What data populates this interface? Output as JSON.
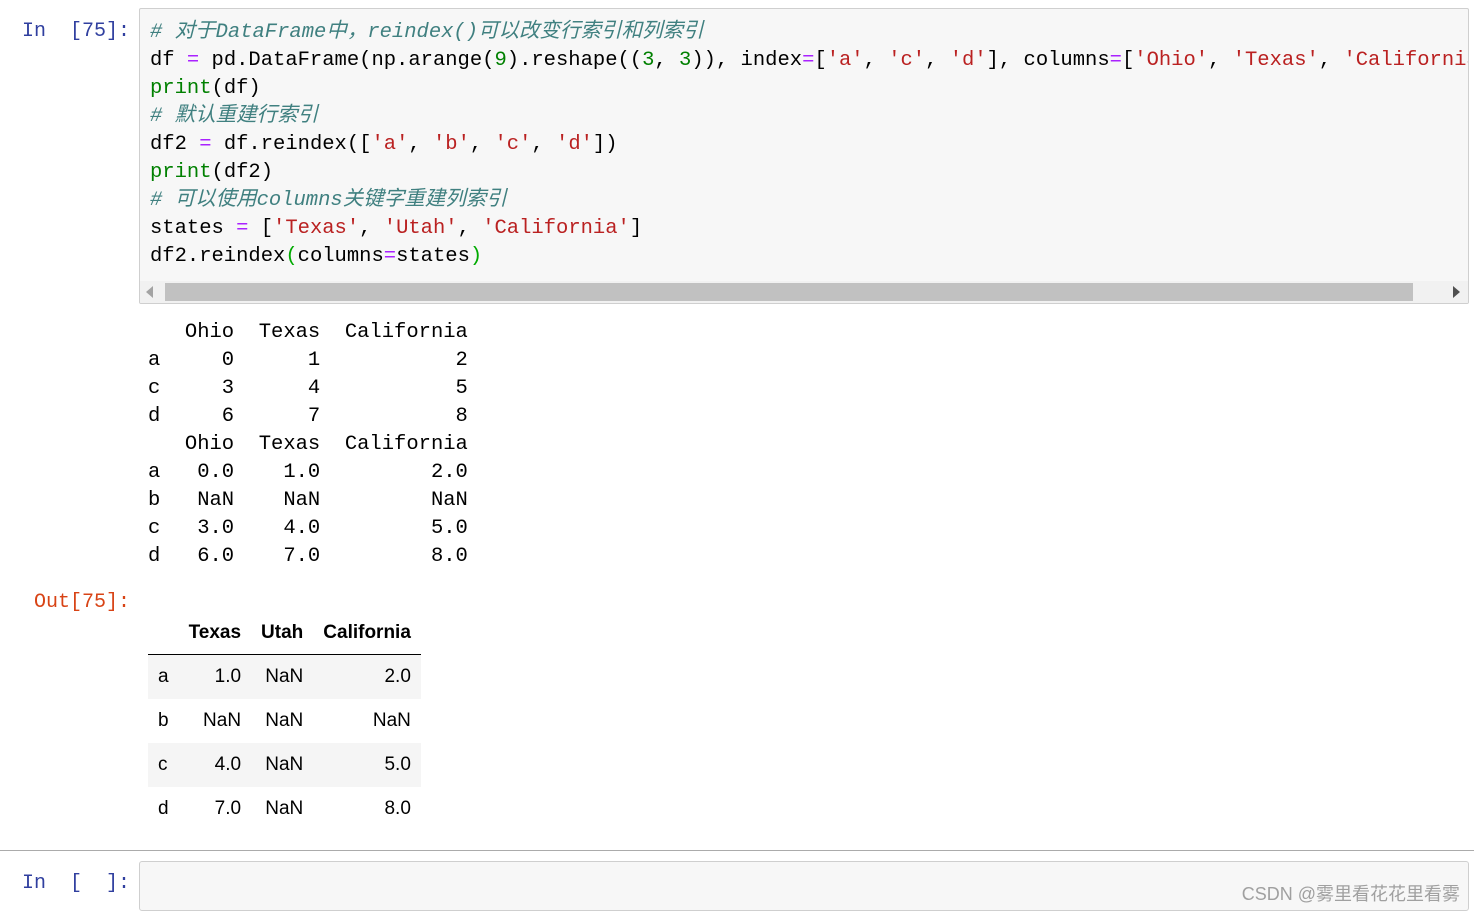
{
  "cell1": {
    "in_prompt": "In  [75]:",
    "out_prompt": "Out[75]:",
    "code": [
      [
        {
          "t": "# 对于DataFrame中，reindex()可以改变行索引和列索引",
          "c": "comment"
        }
      ],
      [
        {
          "t": "df ",
          "c": ""
        },
        {
          "t": "=",
          "c": "op"
        },
        {
          "t": " pd.DataFrame(np.arange(",
          "c": ""
        },
        {
          "t": "9",
          "c": "num"
        },
        {
          "t": ").reshape((",
          "c": ""
        },
        {
          "t": "3",
          "c": "num"
        },
        {
          "t": ", ",
          "c": ""
        },
        {
          "t": "3",
          "c": "num"
        },
        {
          "t": ")), index",
          "c": ""
        },
        {
          "t": "=",
          "c": "op"
        },
        {
          "t": "[",
          "c": ""
        },
        {
          "t": "'a'",
          "c": "str"
        },
        {
          "t": ", ",
          "c": ""
        },
        {
          "t": "'c'",
          "c": "str"
        },
        {
          "t": ", ",
          "c": ""
        },
        {
          "t": "'d'",
          "c": "str"
        },
        {
          "t": "], columns",
          "c": ""
        },
        {
          "t": "=",
          "c": "op"
        },
        {
          "t": "[",
          "c": ""
        },
        {
          "t": "'Ohio'",
          "c": "str"
        },
        {
          "t": ", ",
          "c": ""
        },
        {
          "t": "'Texas'",
          "c": "str"
        },
        {
          "t": ", ",
          "c": ""
        },
        {
          "t": "'California'",
          "c": "str"
        },
        {
          "t": "])",
          "c": ""
        }
      ],
      [
        {
          "t": "print",
          "c": "builtin"
        },
        {
          "t": "(df)",
          "c": ""
        }
      ],
      [
        {
          "t": "# 默认重建行索引",
          "c": "comment"
        }
      ],
      [
        {
          "t": "df2 ",
          "c": ""
        },
        {
          "t": "=",
          "c": "op"
        },
        {
          "t": " df.reindex([",
          "c": ""
        },
        {
          "t": "'a'",
          "c": "str"
        },
        {
          "t": ", ",
          "c": ""
        },
        {
          "t": "'b'",
          "c": "str"
        },
        {
          "t": ", ",
          "c": ""
        },
        {
          "t": "'c'",
          "c": "str"
        },
        {
          "t": ", ",
          "c": ""
        },
        {
          "t": "'d'",
          "c": "str"
        },
        {
          "t": "])",
          "c": ""
        }
      ],
      [
        {
          "t": "print",
          "c": "builtin"
        },
        {
          "t": "(df2)",
          "c": ""
        }
      ],
      [
        {
          "t": "# 可以使用columns关键字重建列索引",
          "c": "comment"
        }
      ],
      [
        {
          "t": "states ",
          "c": ""
        },
        {
          "t": "=",
          "c": "op"
        },
        {
          "t": " [",
          "c": ""
        },
        {
          "t": "'Texas'",
          "c": "str"
        },
        {
          "t": ", ",
          "c": ""
        },
        {
          "t": "'Utah'",
          "c": "str"
        },
        {
          "t": ", ",
          "c": ""
        },
        {
          "t": "'California'",
          "c": "str"
        },
        {
          "t": "]",
          "c": ""
        }
      ],
      [
        {
          "t": "df2.reindex",
          "c": ""
        },
        {
          "t": "(",
          "c": "paren-g"
        },
        {
          "t": "columns",
          "c": ""
        },
        {
          "t": "=",
          "c": "op"
        },
        {
          "t": "states",
          "c": ""
        },
        {
          "t": ")",
          "c": "paren-g"
        }
      ]
    ],
    "stdout": [
      "   Ohio  Texas  California",
      "a     0      1           2",
      "c     3      4           5",
      "d     6      7           8",
      "   Ohio  Texas  California",
      "a   0.0    1.0         2.0",
      "b   NaN    NaN         NaN",
      "c   3.0    4.0         5.0",
      "d   6.0    7.0         8.0"
    ],
    "result_table": {
      "columns": [
        "",
        "Texas",
        "Utah",
        "California"
      ],
      "rows": [
        [
          "a",
          "1.0",
          "NaN",
          "2.0"
        ],
        [
          "b",
          "NaN",
          "NaN",
          "NaN"
        ],
        [
          "c",
          "4.0",
          "NaN",
          "5.0"
        ],
        [
          "d",
          "7.0",
          "NaN",
          "8.0"
        ]
      ]
    }
  },
  "cell2": {
    "in_prompt": "In  [  ]:",
    "code": ""
  },
  "watermark": "CSDN @雾里看花花里看雾",
  "colors": {
    "in_prompt": "#303f9f",
    "out_prompt": "#d84315",
    "comment": "#408080",
    "string": "#ba2121",
    "operator": "#aa22ff",
    "number": "#008000"
  }
}
